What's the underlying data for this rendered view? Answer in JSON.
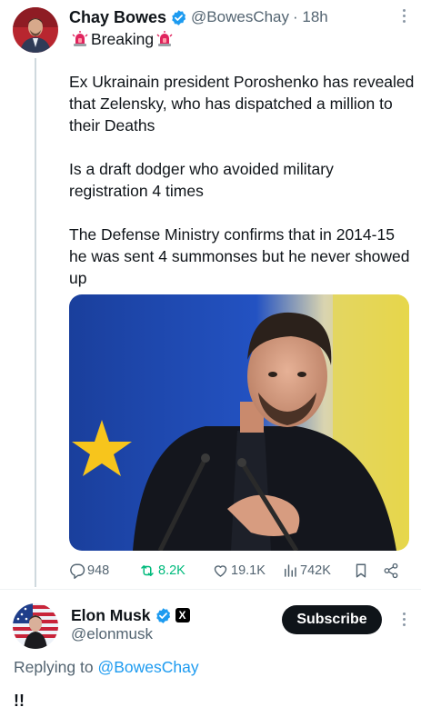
{
  "tweet": {
    "author_name": "Chay Bowes",
    "author_handle": "@BowesChay",
    "time": "· 18h",
    "breaking_label": "Breaking",
    "paragraphs": [
      "Ex Ukrainain president Poroshenko has revealed that Zelensky, who has dispatched a million to their Deaths",
      "Is a draft dodger who avoided military registration 4 times",
      "The Defense Ministry confirms that in 2014-15 he was sent 4 summonses but he never showed up"
    ],
    "stats": {
      "replies": "948",
      "reposts": "8.2K",
      "likes": "19.1K",
      "views": "742K"
    },
    "colors": {
      "repost_active": "#00ba7c",
      "verified": "#1d9bf0"
    }
  },
  "reply": {
    "author_name": "Elon Musk",
    "author_handle": "@elonmusk",
    "subscribe_label": "Subscribe",
    "replying_prefix": "Replying to",
    "replying_to": "@BowesChay",
    "text": "!!"
  },
  "icons": [
    "verified-badge-icon",
    "siren-icon",
    "more-icon",
    "reply-icon",
    "repost-icon",
    "like-icon",
    "views-icon",
    "bookmark-icon",
    "share-icon",
    "x-badge-icon"
  ]
}
